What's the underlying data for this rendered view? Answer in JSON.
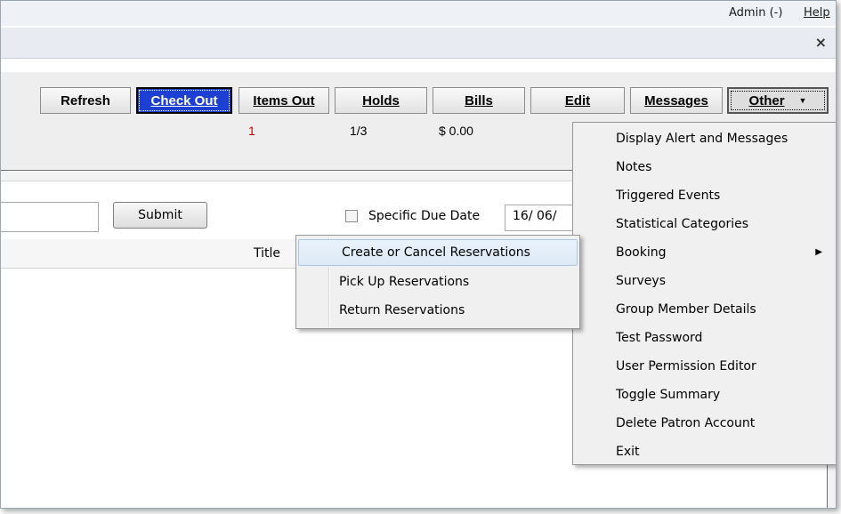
{
  "header": {
    "admin_label": "Admin (-)",
    "help_label": "Help",
    "close_glyph": "×"
  },
  "toolbar": {
    "buttons": [
      {
        "label": "Refresh"
      },
      {
        "label": "Check Out"
      },
      {
        "label": "Items Out"
      },
      {
        "label": "Holds"
      },
      {
        "label": "Bills"
      },
      {
        "label": "Edit"
      },
      {
        "label": "Messages"
      },
      {
        "label": "Other"
      }
    ]
  },
  "summary": {
    "items_out": "1",
    "holds": "1/3",
    "bills": "$ 0.00"
  },
  "checkout": {
    "submit_label": "Submit",
    "specific_due_date_label": "Specific Due Date",
    "due_date_value": "16/ 06/",
    "title_column": "Title"
  },
  "other_menu": {
    "items": [
      {
        "label": "Display Alert and Messages"
      },
      {
        "label": "Notes"
      },
      {
        "label": "Triggered Events"
      },
      {
        "label": "Statistical Categories"
      },
      {
        "label": "Booking"
      },
      {
        "label": "Surveys"
      },
      {
        "label": "Group Member Details"
      },
      {
        "label": "Test Password"
      },
      {
        "label": "User Permission Editor"
      },
      {
        "label": "Toggle Summary"
      },
      {
        "label": "Delete Patron Account"
      },
      {
        "label": "Exit"
      }
    ]
  },
  "booking_submenu": {
    "items": [
      {
        "label": "Create or Cancel Reservations"
      },
      {
        "label": "Pick Up Reservations"
      },
      {
        "label": "Return Reservations"
      }
    ]
  },
  "colors": {
    "active_button": "#1d3fd4",
    "items_out_count": "#d40000",
    "menu_highlight": "#dde9f6"
  }
}
